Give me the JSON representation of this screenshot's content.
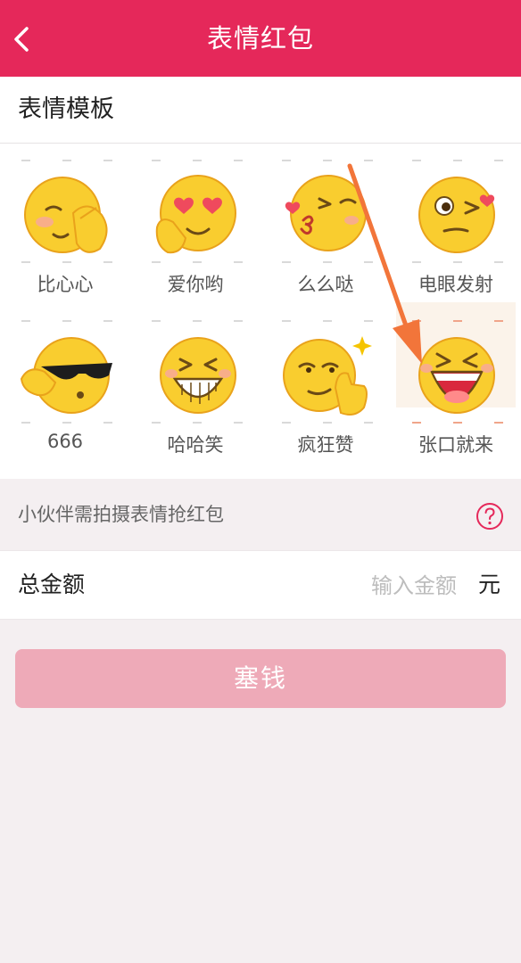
{
  "header": {
    "title": "表情红包",
    "back_icon": "chevron-left-icon"
  },
  "templates": {
    "heading": "表情模板",
    "items": [
      {
        "label": "比心心",
        "icon": "finger-heart-emoji-icon"
      },
      {
        "label": "爱你哟",
        "icon": "heart-eyes-emoji-icon"
      },
      {
        "label": "么么哒",
        "icon": "kiss-emoji-icon"
      },
      {
        "label": "电眼发射",
        "icon": "wink-emoji-icon"
      },
      {
        "label": "666",
        "icon": "sunglasses-emoji-icon"
      },
      {
        "label": "哈哈笑",
        "icon": "laugh-emoji-icon"
      },
      {
        "label": "疯狂赞",
        "icon": "thumbs-up-emoji-icon"
      },
      {
        "label": "张口就来",
        "icon": "open-mouth-laugh-emoji-icon",
        "selected": true
      }
    ]
  },
  "hint": {
    "text": "小伙伴需拍摄表情抢红包",
    "icon": "question-circle-icon"
  },
  "amount": {
    "label": "总金额",
    "placeholder": "输入金额",
    "value": "",
    "unit": "元"
  },
  "submit": {
    "label": "塞钱"
  },
  "colors": {
    "brand": "#e5285a",
    "button_disabled": "#eeaab8",
    "arrow": "#f2753a"
  }
}
